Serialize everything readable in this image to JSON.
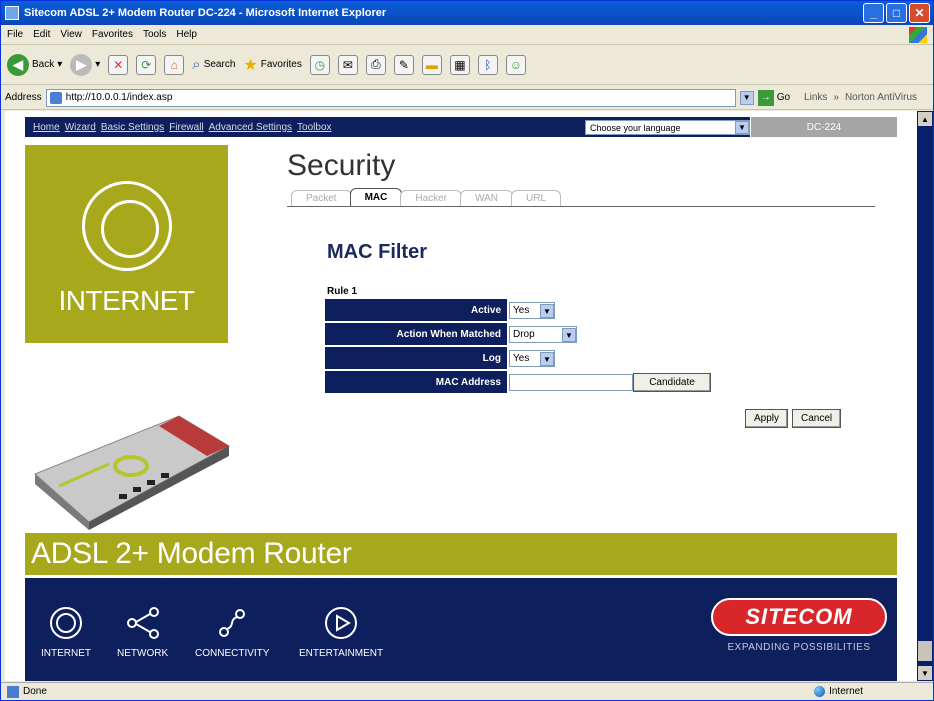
{
  "window": {
    "title": "Sitecom ADSL 2+ Modem Router DC-224 - Microsoft Internet Explorer"
  },
  "menu": [
    "File",
    "Edit",
    "View",
    "Favorites",
    "Tools",
    "Help"
  ],
  "toolbar": {
    "back": "Back",
    "search": "Search",
    "favorites": "Favorites"
  },
  "address": {
    "label": "Address",
    "url": "http://10.0.0.1/index.asp",
    "go": "Go",
    "links": "Links",
    "extra": "Norton AntiVirus"
  },
  "nav": [
    "Home",
    "Wizard",
    "Basic Settings",
    "Firewall",
    "Advanced Settings",
    "Toolbox"
  ],
  "language": {
    "placeholder": "Choose your language"
  },
  "model": "DC-224",
  "left_panel": {
    "label": "INTERNET"
  },
  "section": {
    "title": "Security"
  },
  "tabs": [
    {
      "label": "Packet",
      "active": false
    },
    {
      "label": "MAC",
      "active": true
    },
    {
      "label": "Hacker",
      "active": false
    },
    {
      "label": "WAN",
      "active": false
    },
    {
      "label": "URL",
      "active": false
    }
  ],
  "page": {
    "heading": "MAC Filter",
    "rule": "Rule 1"
  },
  "form": {
    "active": {
      "label": "Active",
      "value": "Yes"
    },
    "action": {
      "label": "Action When Matched",
      "value": "Drop"
    },
    "log": {
      "label": "Log",
      "value": "Yes"
    },
    "mac": {
      "label": "MAC Address",
      "value": "",
      "candidate": "Candidate"
    }
  },
  "buttons": {
    "apply": "Apply",
    "cancel": "Cancel"
  },
  "banner": "ADSL 2+ Modem Router",
  "footer": {
    "items": [
      "INTERNET",
      "NETWORK",
      "CONNECTIVITY",
      "ENTERTAINMENT"
    ],
    "brand": "SITECOM",
    "slogan": "EXPANDING POSSIBILITIES"
  },
  "status": {
    "left": "Done",
    "zone": "Internet"
  },
  "colors": {
    "navy": "#0d1f5c",
    "olive": "#a8a81c",
    "brand_red": "#d8262a"
  }
}
